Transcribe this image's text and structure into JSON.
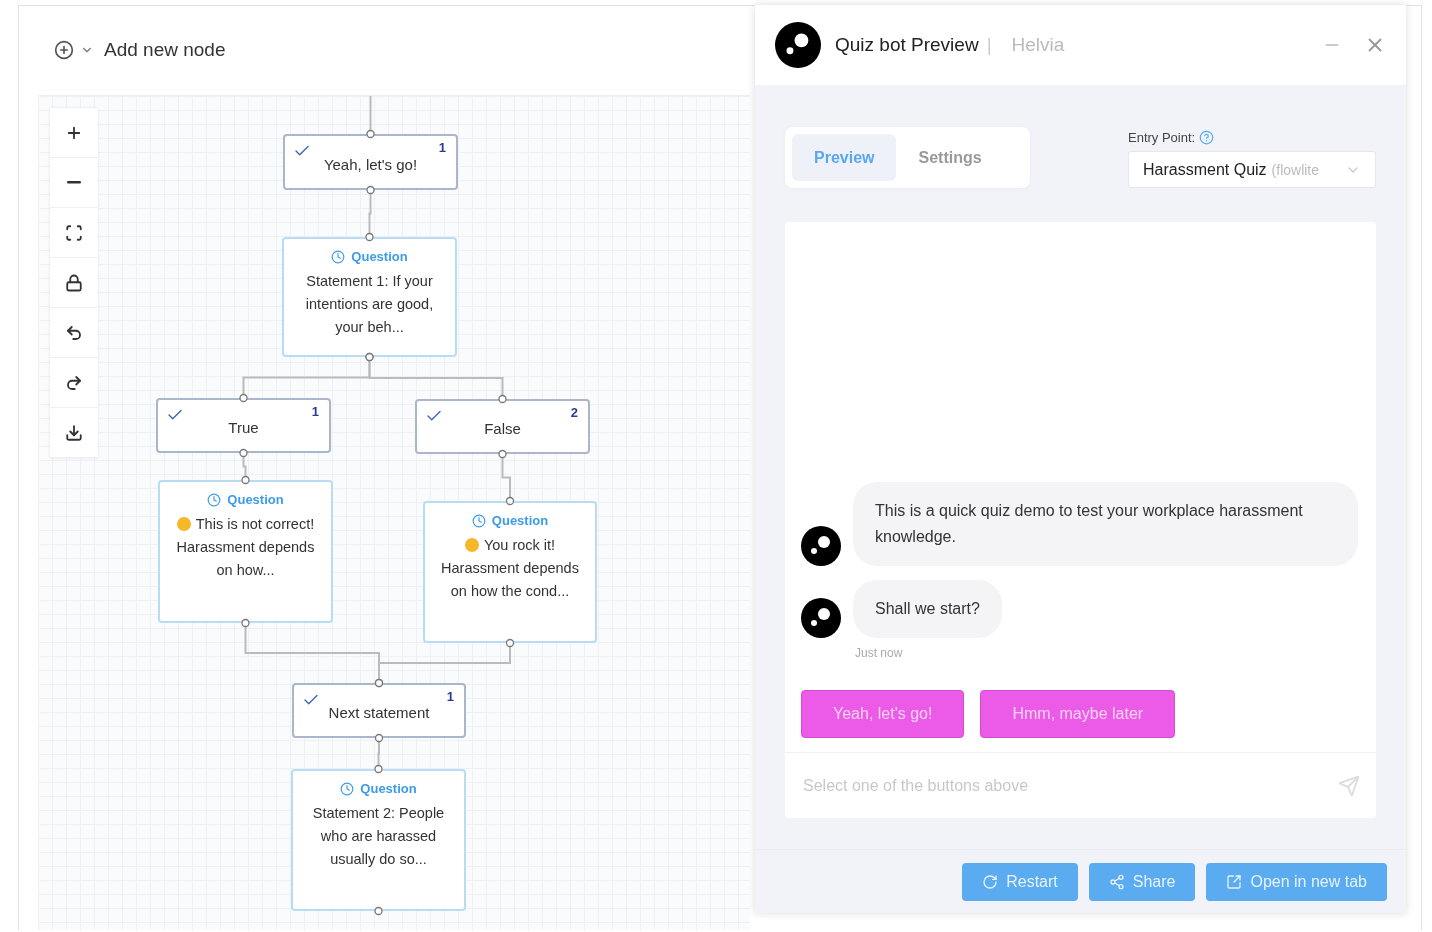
{
  "builder": {
    "add_label": "Add new node"
  },
  "nodes": [
    {
      "kind": "option",
      "label": "Yeah, let's go!",
      "checked": true,
      "count": "1"
    },
    {
      "kind": "question",
      "type_label": "Question",
      "has_emoji": false,
      "text": "Statement 1: If your intentions are good, your beh..."
    },
    {
      "kind": "option",
      "label": "True",
      "checked": true,
      "count": "1"
    },
    {
      "kind": "option",
      "label": "False",
      "checked": true,
      "count": "2"
    },
    {
      "kind": "question",
      "type_label": "Question",
      "has_emoji": true,
      "text": "This is not correct! Harassment depends on how..."
    },
    {
      "kind": "question",
      "type_label": "Question",
      "has_emoji": true,
      "text": "You rock it! Harassment depends on how the cond..."
    },
    {
      "kind": "option",
      "label": "Next statement",
      "checked": true,
      "count": "1"
    },
    {
      "kind": "question",
      "type_label": "Question",
      "has_emoji": false,
      "text": "Statement 2: People who are harassed usually do so..."
    }
  ],
  "preview": {
    "title": "Quiz bot Preview",
    "separator": "|",
    "brand": "Helvia",
    "tabs": [
      {
        "label": "Preview",
        "selected": true
      },
      {
        "label": "Settings",
        "selected": false
      }
    ],
    "entry_point": {
      "label": "Entry Point:",
      "value": "Harassment Quiz",
      "value_suffix": "(flowlite"
    },
    "messages": [
      {
        "text": "This is a quick quiz demo to test your workplace harassment knowledge."
      },
      {
        "text": "Shall we start?"
      }
    ],
    "timestamp": "Just now",
    "quick_replies": [
      "Yeah, let's go!",
      "Hmm, maybe later"
    ],
    "input": {
      "placeholder": "Select one of the buttons above"
    },
    "actions": [
      {
        "kind": "restart",
        "label": "Restart"
      },
      {
        "kind": "share",
        "label": "Share"
      },
      {
        "kind": "open",
        "label": "Open in new tab"
      }
    ]
  }
}
